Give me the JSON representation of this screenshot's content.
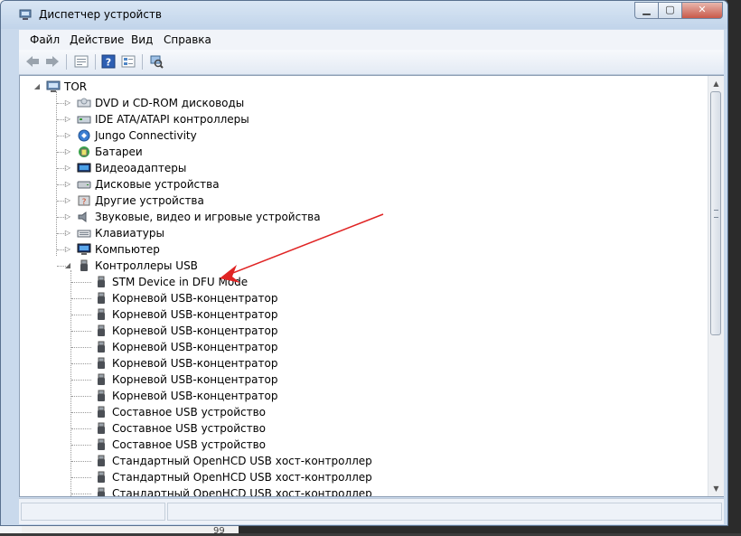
{
  "window": {
    "title": "Диспетчер устройств"
  },
  "menu": [
    "Файл",
    "Действие",
    "Вид",
    "Справка"
  ],
  "toolbar": {
    "buttons": [
      "back-icon",
      "forward-icon",
      "properties-list-icon",
      "help-icon",
      "details-icon",
      "scan-hardware-icon"
    ]
  },
  "tree": {
    "root": "TOR",
    "categories": [
      {
        "label": "DVD и CD-ROM дисководы",
        "icon": "dvd-drive-icon",
        "expanded": false
      },
      {
        "label": "IDE ATA/ATAPI контроллеры",
        "icon": "ide-controller-icon",
        "expanded": false
      },
      {
        "label": "Jungo Connectivity",
        "icon": "jungo-icon",
        "expanded": false
      },
      {
        "label": "Батареи",
        "icon": "battery-icon",
        "expanded": false
      },
      {
        "label": "Видеоадаптеры",
        "icon": "display-adapter-icon",
        "expanded": false
      },
      {
        "label": "Дисковые устройства",
        "icon": "disk-drive-icon",
        "expanded": false
      },
      {
        "label": "Другие устройства",
        "icon": "other-device-icon",
        "expanded": false
      },
      {
        "label": "Звуковые, видео и игровые устройства",
        "icon": "sound-icon",
        "expanded": false
      },
      {
        "label": "Клавиатуры",
        "icon": "keyboard-icon",
        "expanded": false
      },
      {
        "label": "Компьютер",
        "icon": "computer-icon",
        "expanded": false
      },
      {
        "label": "Контроллеры USB",
        "icon": "usb-icon",
        "expanded": true
      }
    ],
    "usb_devices": [
      "STM Device in DFU Mode",
      "Корневой USB-концентратор",
      "Корневой USB-концентратор",
      "Корневой USB-концентратор",
      "Корневой USB-концентратор",
      "Корневой USB-концентратор",
      "Корневой USB-концентратор",
      "Корневой USB-концентратор",
      "Составное USB устройство",
      "Составное USB устройство",
      "Составное USB устройство",
      "Стандартный OpenHCD USB хост-контроллер",
      "Стандартный OpenHCD USB хост-контроллер",
      "Стандартный OpenHCD USB хост-контроллер"
    ]
  },
  "background": {
    "left_fragments": [
      "oje",
      "y b"
    ],
    "bottom_fragment": "99"
  },
  "colors": {
    "annotation_arrow": "#e02424"
  }
}
